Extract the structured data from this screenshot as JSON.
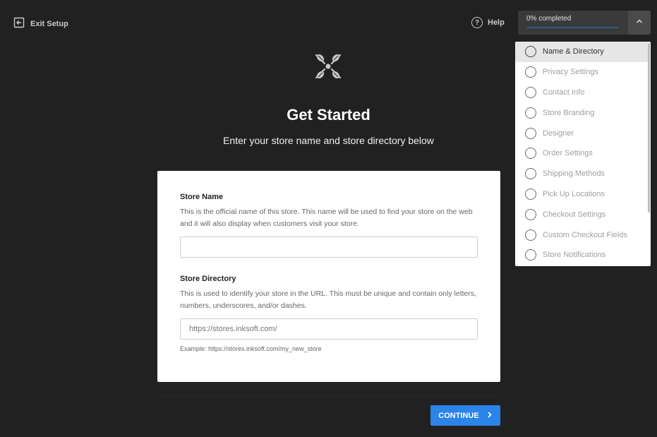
{
  "topbar": {
    "exit_label": "Exit Setup",
    "help_label": "Help",
    "help_glyph": "?"
  },
  "progress": {
    "label": "0% completed",
    "fraction": 0
  },
  "steps": [
    {
      "label": "Name & Directory",
      "active": true
    },
    {
      "label": "Privacy Settings",
      "active": false
    },
    {
      "label": "Contact Info",
      "active": false
    },
    {
      "label": "Store Branding",
      "active": false
    },
    {
      "label": "Designer",
      "active": false
    },
    {
      "label": "Order Settings",
      "active": false
    },
    {
      "label": "Shipping Methods",
      "active": false
    },
    {
      "label": "Pick Up Locations",
      "active": false
    },
    {
      "label": "Checkout Settings",
      "active": false
    },
    {
      "label": "Custom Checkout Fields",
      "active": false
    },
    {
      "label": "Store Notifications",
      "active": false
    }
  ],
  "hero": {
    "title": "Get Started",
    "subtitle": "Enter your store name and store directory below"
  },
  "form": {
    "store_name": {
      "label": "Store Name",
      "description": "This is the official name of this store. This name will be used to find your store on the web and it will also display when customers visit your store.",
      "value": "",
      "placeholder": ""
    },
    "store_directory": {
      "label": "Store Directory",
      "description": "This is used to identify your store in the URL. This must be unique and contain only letters, numbers, underscores, and/or dashes.",
      "value": "",
      "placeholder": "https://stores.inksoft.com/",
      "example": "Example: https://stores.inksoft.com/my_new_store"
    }
  },
  "actions": {
    "continue_label": "CONTINUE"
  },
  "colors": {
    "background": "#212121",
    "accent": "#2b84e8",
    "card": "#ffffff"
  },
  "icons": {
    "exit": "exit-icon",
    "help": "help-icon",
    "chevron_up": "chevron-up-icon",
    "radio": "radio-unchecked-icon",
    "logo": "inksoft-logo",
    "chevron_right": "chevron-right-icon"
  }
}
